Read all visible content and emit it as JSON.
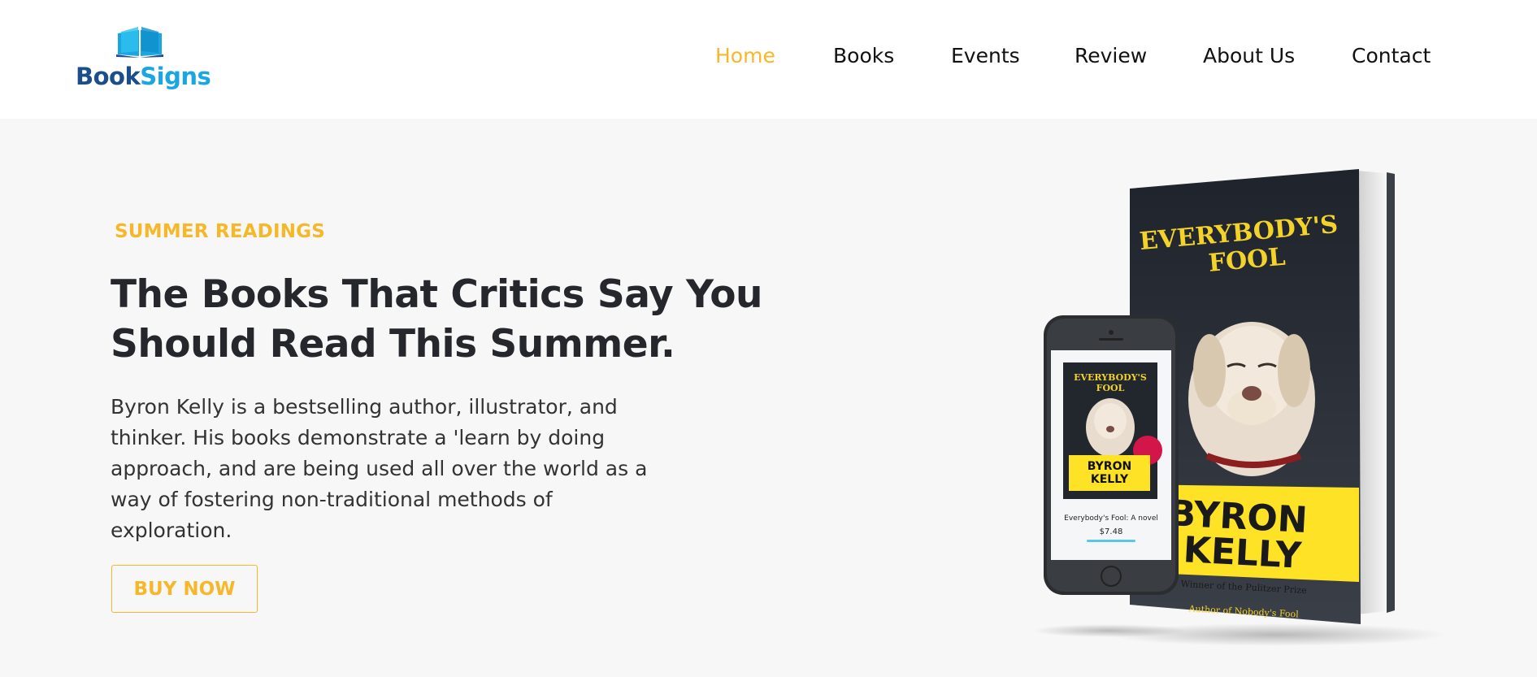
{
  "brand": {
    "name_part1": "Book",
    "name_part2": "Signs",
    "colors": {
      "primary": "#1c4d8c",
      "secondary": "#1aa6e0"
    }
  },
  "nav": {
    "items": [
      {
        "label": "Home",
        "active": true
      },
      {
        "label": "Books",
        "active": false
      },
      {
        "label": "Events",
        "active": false
      },
      {
        "label": "Review",
        "active": false
      },
      {
        "label": "About Us",
        "active": false
      },
      {
        "label": "Contact",
        "active": false
      }
    ]
  },
  "hero": {
    "eyebrow": "SUMMER READINGS",
    "title_line1": "The Books That Critics Say You",
    "title_line2": "Should Read This Summer.",
    "description": "Byron Kelly is a bestselling author, illustrator, and thinker. His books demonstrate a 'learn by doing approach, and are being used all over the world as a way of fostering non-traditional methods of exploration.",
    "cta_label": "BUY NOW"
  },
  "book": {
    "title": "EVERYBODY'S FOOL",
    "author_line1": "BYRON",
    "author_line2": "KELLY",
    "award": "Winner of the Pulitzer Prize",
    "tagline": "Author of Nobody's Fool"
  },
  "phone": {
    "product_name": "Everybody's Fool: A novel",
    "price": "$7.48"
  },
  "theme": {
    "accent": "#f6b829",
    "hero_bg": "#f7f7f7",
    "book_yellow": "#fde225"
  }
}
